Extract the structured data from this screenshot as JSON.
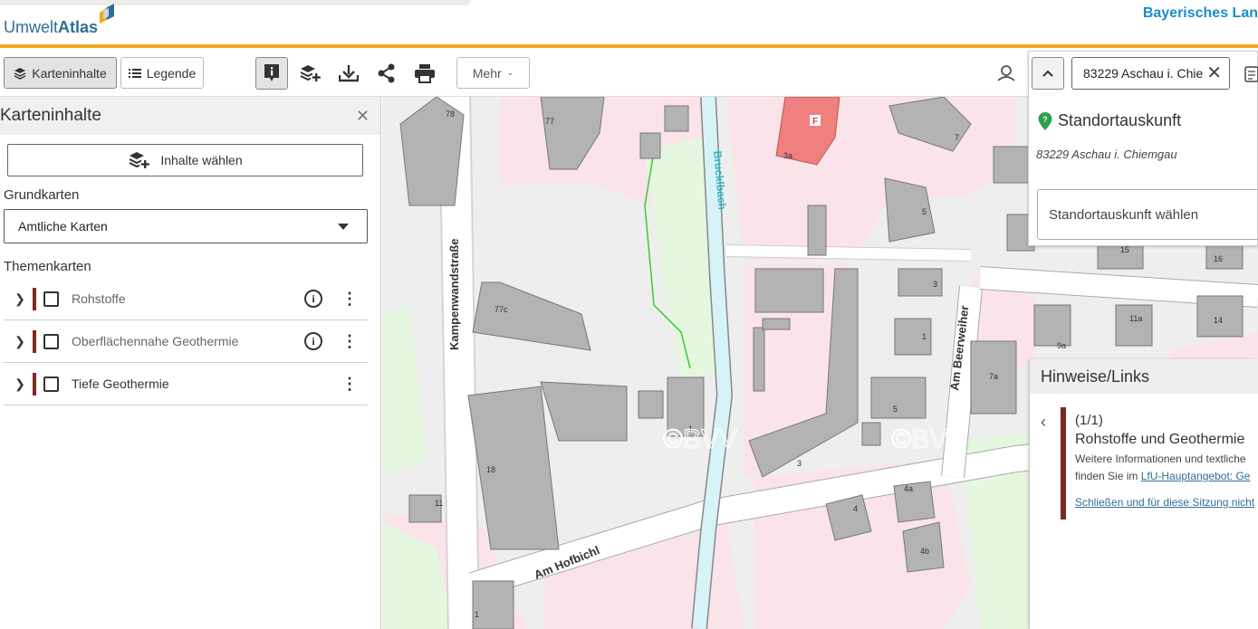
{
  "header": {
    "logo_light": "Umwelt",
    "logo_bold": "Atlas",
    "agency": "Bayerisches Lan",
    "accent": "#f4a81d",
    "brand": "#2f6e96"
  },
  "toolbar": {
    "karteninhalte_label": "Karteninhalte",
    "legende_label": "Legende",
    "mehr_label": "Mehr",
    "icons": [
      "info-icon",
      "add-layers-icon",
      "download-icon",
      "share-icon",
      "print-icon",
      "user-icon"
    ]
  },
  "sidebar": {
    "title": "Karteninhalte",
    "inhalte_button": "Inhalte wählen",
    "grundkarten_heading": "Grundkarten",
    "grundkarten_value": "Amtliche Karten",
    "themenkarten_heading": "Themenkarten",
    "layers": [
      {
        "label": "Rohstoffe",
        "has_info": true
      },
      {
        "label": "Oberflächennahe Geothermie",
        "has_info": true
      },
      {
        "label": "Tiefe Geothermie",
        "has_info": false
      }
    ],
    "layer_color": "#7a2a22"
  },
  "search": {
    "value": "83229 Aschau i. Chie",
    "standort_title": "Standortauskunft",
    "standort_address": "83229 Aschau i. Chiemgau",
    "standort_select_placeholder": "Standortauskunft wählen"
  },
  "hinweise": {
    "title": "Hinweise/Links",
    "count": "(1/1)",
    "heading": "Rohstoffe und Geothermie",
    "text_line1": "Weitere Informationen und textliche",
    "text_line2_prefix": "finden Sie im ",
    "link_text": "LfU-Hauptangebot: Ge",
    "close_link": "Schließen und für diese Sitzung nicht"
  },
  "map": {
    "street_labels": [
      "Kampenwandstraße",
      "Am Hofbichl",
      "Am Beerweiher",
      "Brucklbach"
    ],
    "house_numbers": [
      "78",
      "77",
      "3a",
      "7",
      "5",
      "3",
      "1",
      "7a",
      "9a",
      "11a",
      "15",
      "16",
      "14",
      "3",
      "4",
      "4a",
      "4b",
      "77c",
      "1",
      "18",
      "11",
      "5",
      "1"
    ],
    "watermark": "©BVV",
    "fire_marker": "F"
  }
}
